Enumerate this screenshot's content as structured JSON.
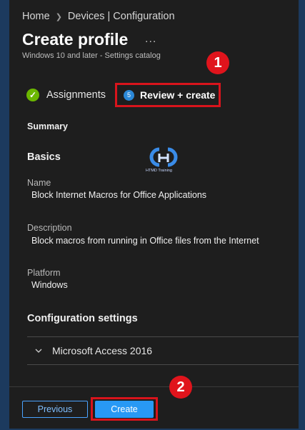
{
  "breadcrumb": {
    "home": "Home",
    "section": "Devices | Configuration"
  },
  "header": {
    "title": "Create profile",
    "more": "...",
    "subtitle": "Windows 10 and later - Settings catalog"
  },
  "callouts": {
    "one": "1",
    "two": "2"
  },
  "tabs": {
    "assignments": "Assignments",
    "review_step": "5",
    "review": "Review + create"
  },
  "summary": {
    "label": "Summary",
    "basics": "Basics",
    "logo_text": "HTMD Training",
    "name_label": "Name",
    "name_value": "Block Internet Macros for Office Applications",
    "description_label": "Description",
    "description_value": "Block macros from running in Office files from the Internet",
    "platform_label": "Platform",
    "platform_value": "Windows"
  },
  "config": {
    "heading": "Configuration settings",
    "item": "Microsoft Access 2016"
  },
  "footer": {
    "previous": "Previous",
    "create": "Create"
  },
  "colors": {
    "accent": "#2899f5",
    "callout": "#e0141c",
    "success": "#6bb700",
    "background": "#1e1e1e"
  }
}
